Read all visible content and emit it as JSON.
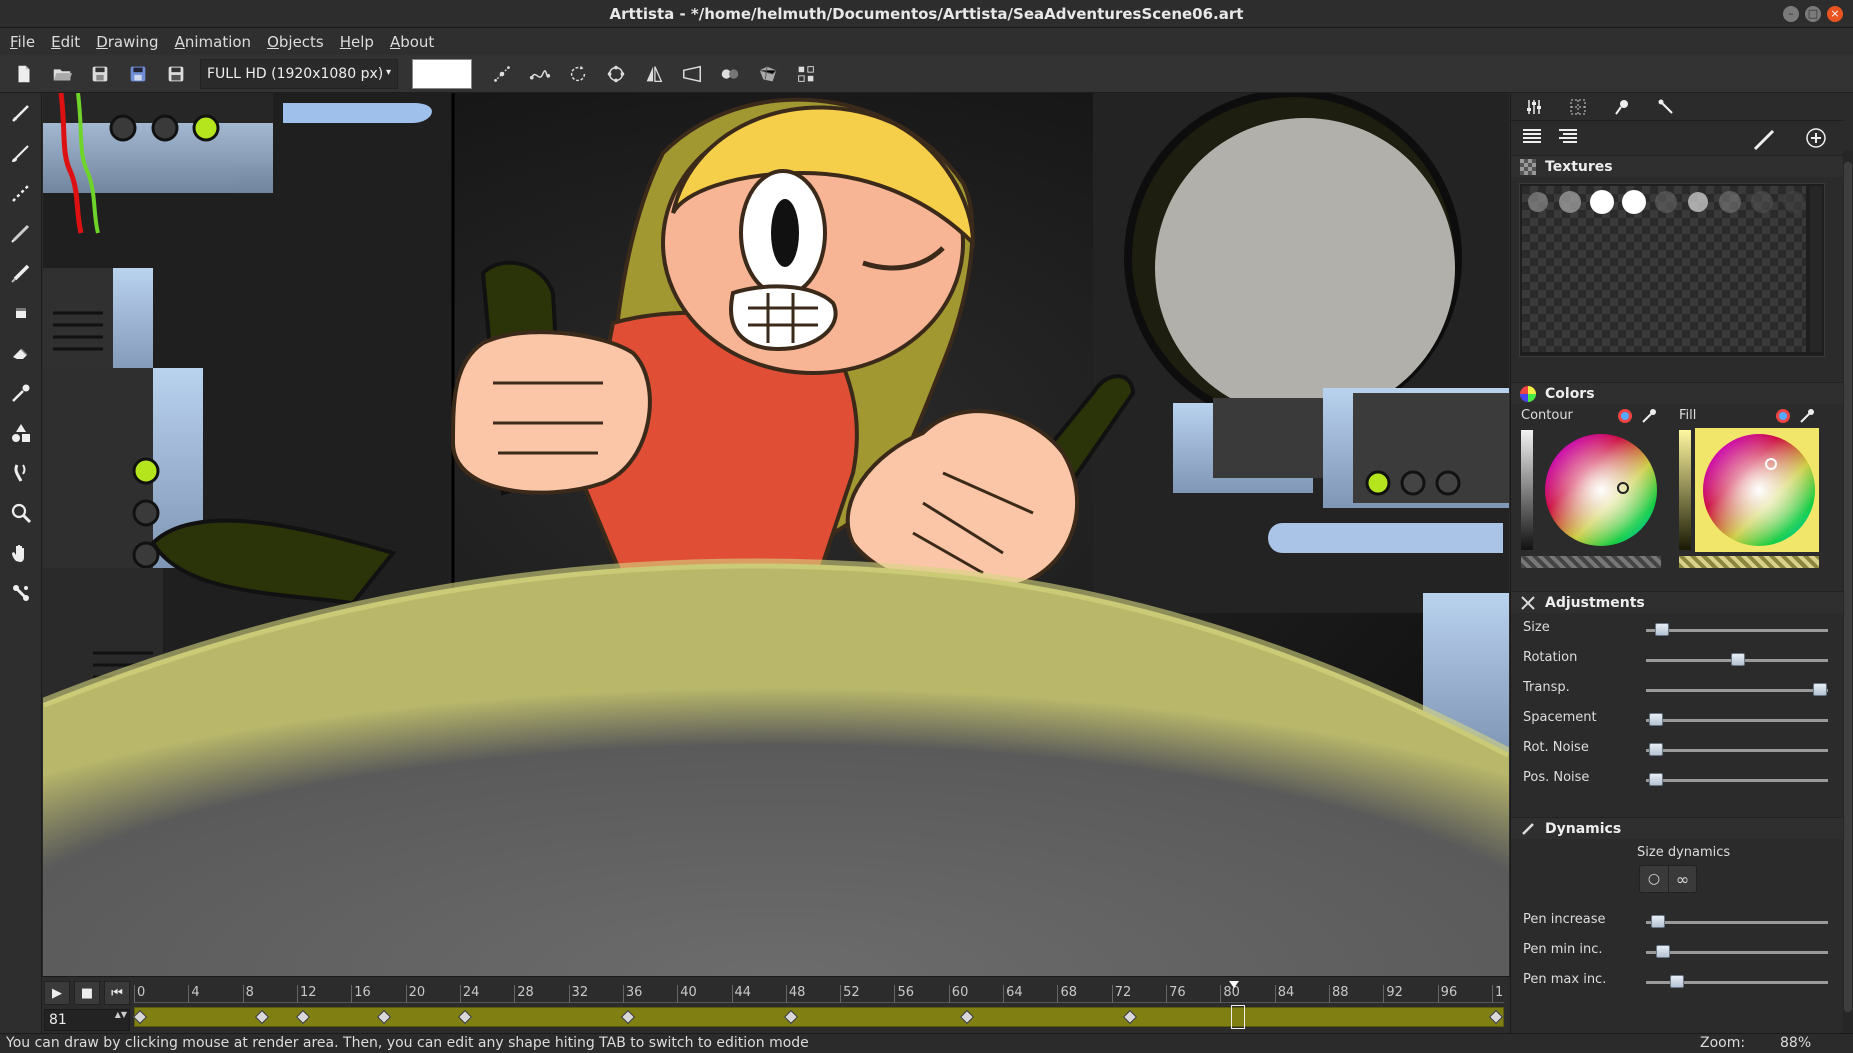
{
  "window": {
    "title": "Arttista - */home/helmuth/Documentos/Arttista/SeaAdventuresScene06.art",
    "min_glyph": "–",
    "max_glyph": "□",
    "close_glyph": "×"
  },
  "menubar": {
    "items": [
      {
        "label": "File",
        "accel": "F",
        "rest": "ile"
      },
      {
        "label": "Edit",
        "accel": "E",
        "rest": "dit"
      },
      {
        "label": "Drawing",
        "accel": "D",
        "rest": "rawing"
      },
      {
        "label": "Animation",
        "accel": "A",
        "rest": "nimation"
      },
      {
        "label": "Objects",
        "accel": "O",
        "rest": "bjects"
      },
      {
        "label": "Help",
        "accel": "H",
        "rest": "elp"
      },
      {
        "label": "About",
        "accel": "A",
        "rest": "bout"
      }
    ]
  },
  "toolbar": {
    "resolution": "FULL HD (1920x1080 px)",
    "resolution_arrow": "▾",
    "background_color": "#ffffff"
  },
  "timeline": {
    "play_glyph": "▶",
    "stop_glyph": "■",
    "rewind_glyph": "⏮",
    "current_frame": "81",
    "spin_glyph": "▲▼",
    "ruler_labels": [
      "0",
      "4",
      "8",
      "12",
      "16",
      "20",
      "24",
      "28",
      "32",
      "36",
      "40",
      "44",
      "48",
      "52",
      "56",
      "60",
      "64",
      "68",
      "72",
      "76",
      "80",
      "84",
      "88",
      "92",
      "96",
      "1"
    ],
    "keyframes": [
      0,
      9,
      12,
      18,
      24,
      36,
      48,
      61,
      73,
      100
    ],
    "playhead_frame": 81,
    "track_color": "#7f7f12"
  },
  "panel": {
    "textures_title": "Textures",
    "colors_title": "Colors",
    "contour_label": "Contour",
    "fill_label": "Fill",
    "adjustments_title": "Adjustments",
    "adjustments": [
      {
        "label": "Size",
        "value": 0.05
      },
      {
        "label": "Rotation",
        "value": 0.5
      },
      {
        "label": "Transp.",
        "value": 0.98
      },
      {
        "label": "Spacement",
        "value": 0.02
      },
      {
        "label": "Rot. Noise",
        "value": 0.02
      },
      {
        "label": "Pos. Noise",
        "value": 0.02
      }
    ],
    "dynamics_title": "Dynamics",
    "size_dynamics_label": "Size dynamics",
    "dyn_btn1": "○",
    "dyn_btn2": "∞",
    "dynamics": [
      {
        "label": "Pen increase",
        "value": 0.03
      },
      {
        "label": "Pen min inc.",
        "value": 0.06
      },
      {
        "label": "Pen max inc.",
        "value": 0.14
      }
    ],
    "contour_color": "#e8e8e8",
    "fill_color": "#f2e66a"
  },
  "statusbar": {
    "message": "You can draw by clicking mouse at render area. Then, you can edit any shape hiting TAB to switch to edition mode",
    "zoom_label": "Zoom:",
    "zoom_value": "88%"
  }
}
